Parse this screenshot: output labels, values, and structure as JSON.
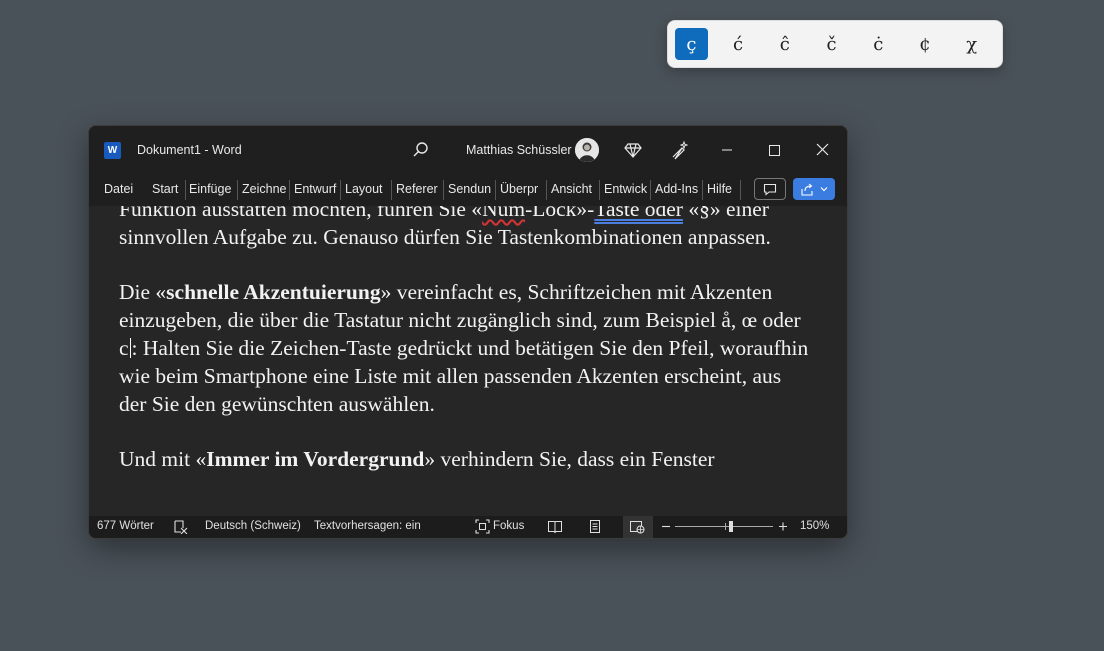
{
  "accent_picker": {
    "chars": [
      "ç",
      "ć",
      "ĉ",
      "č",
      "ċ",
      "¢",
      "χ"
    ],
    "selected_index": 0
  },
  "window": {
    "title": "Dokument1  -  Word",
    "user_name": "Matthias Schüssler"
  },
  "ribbon": {
    "tabs": [
      "Datei",
      "Start",
      "Einfüge",
      "Zeichne",
      "Entwurf",
      "Layout",
      "Referer",
      "Sendun",
      "Überpr",
      "Ansicht",
      "Entwick",
      "Add-Ins",
      "Hilfe"
    ]
  },
  "document": {
    "p1_l1_a": "Funktion ausstatten möchten, führen Sie «",
    "p1_l1_num": "Num",
    "p1_l1_b": "-Lock»-",
    "p1_l1_taste": "Taste  oder",
    "p1_l1_c": " «§»",
    "p1_rest": "einer sinnvollen Aufgabe zu. Genauso dürfen Sie Tastenkombinationen anpassen.",
    "p2_a": "Die «",
    "p2_bold": "schnelle Akzentuierung",
    "p2_b": "» vereinfacht es, Schriftzeichen mit Akzenten einzugeben, die über die Tastatur nicht zugänglich sind, zum Beispiel å, œ oder c",
    "p2_c": ": Halten Sie die Zeichen-Taste gedrückt und betätigen Sie den Pfeil, woraufhin wie beim Smartphone eine Liste mit allen passenden Akzenten erscheint, aus der Sie den gewünschten auswählen.",
    "p3_a": "Und mit «",
    "p3_bold": "Immer im Vordergrund",
    "p3_b": "» verhindern Sie, dass ein Fenster"
  },
  "status": {
    "word_count": "677 Wörter",
    "language": "Deutsch (Schweiz)",
    "predictions": "Textvorhersagen: ein",
    "focus": "Fokus",
    "zoom": "150%"
  },
  "colors": {
    "accent": "#0f6cbd",
    "share": "#3a7ce0"
  }
}
